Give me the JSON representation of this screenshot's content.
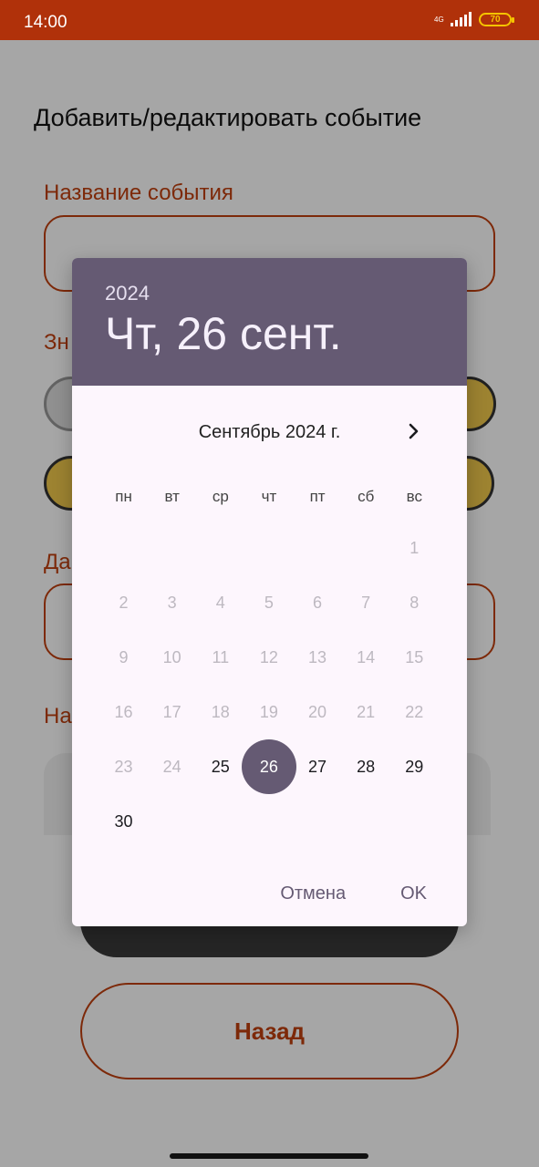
{
  "status_bar": {
    "time": "14:00",
    "network": "4G",
    "battery": "70"
  },
  "form": {
    "title": "Добавить/редактировать событие",
    "event_name_label": "Название события",
    "icon_label": "Зн",
    "date_label": "Да",
    "notes_label": "На",
    "back_button": "Назад"
  },
  "date_picker": {
    "year": "2024",
    "selected_date": "Чт, 26 сент.",
    "month_title": "Сентябрь 2024 г.",
    "weekdays": [
      "пн",
      "вт",
      "ср",
      "чт",
      "пт",
      "сб",
      "вс"
    ],
    "days": [
      {
        "label": ""
      },
      {
        "label": ""
      },
      {
        "label": ""
      },
      {
        "label": ""
      },
      {
        "label": ""
      },
      {
        "label": ""
      },
      {
        "label": "1",
        "state": "disabled"
      },
      {
        "label": "2",
        "state": "disabled"
      },
      {
        "label": "3",
        "state": "disabled"
      },
      {
        "label": "4",
        "state": "disabled"
      },
      {
        "label": "5",
        "state": "disabled"
      },
      {
        "label": "6",
        "state": "disabled"
      },
      {
        "label": "7",
        "state": "disabled"
      },
      {
        "label": "8",
        "state": "disabled"
      },
      {
        "label": "9",
        "state": "disabled"
      },
      {
        "label": "10",
        "state": "disabled"
      },
      {
        "label": "11",
        "state": "disabled"
      },
      {
        "label": "12",
        "state": "disabled"
      },
      {
        "label": "13",
        "state": "disabled"
      },
      {
        "label": "14",
        "state": "disabled"
      },
      {
        "label": "15",
        "state": "disabled"
      },
      {
        "label": "16",
        "state": "disabled"
      },
      {
        "label": "17",
        "state": "disabled"
      },
      {
        "label": "18",
        "state": "disabled"
      },
      {
        "label": "19",
        "state": "disabled"
      },
      {
        "label": "20",
        "state": "disabled"
      },
      {
        "label": "21",
        "state": "disabled"
      },
      {
        "label": "22",
        "state": "disabled"
      },
      {
        "label": "23",
        "state": "disabled"
      },
      {
        "label": "24",
        "state": "disabled"
      },
      {
        "label": "25",
        "state": "enabled"
      },
      {
        "label": "26",
        "state": "selected"
      },
      {
        "label": "27",
        "state": "enabled"
      },
      {
        "label": "28",
        "state": "enabled"
      },
      {
        "label": "29",
        "state": "enabled"
      },
      {
        "label": "30",
        "state": "enabled"
      }
    ],
    "cancel_label": "Отмена",
    "ok_label": "OK"
  },
  "colors": {
    "status_bar": "#b0310a",
    "accent": "#c0400f",
    "dialog_header": "#655a73"
  },
  "icons": {
    "next_month": "chevron-right-icon"
  }
}
